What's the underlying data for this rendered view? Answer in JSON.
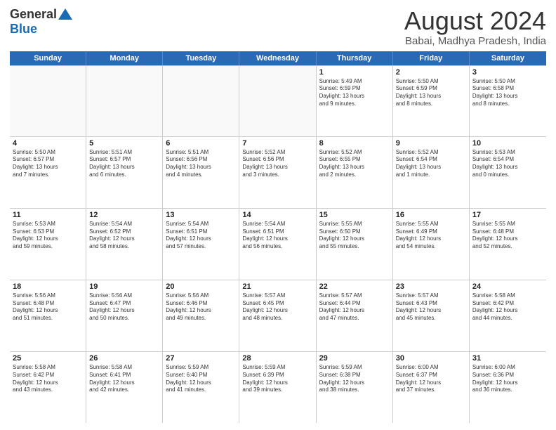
{
  "header": {
    "logo_general": "General",
    "logo_blue": "Blue",
    "month_title": "August 2024",
    "location": "Babai, Madhya Pradesh, India"
  },
  "days_of_week": [
    "Sunday",
    "Monday",
    "Tuesday",
    "Wednesday",
    "Thursday",
    "Friday",
    "Saturday"
  ],
  "weeks": [
    [
      {
        "day": "",
        "info": ""
      },
      {
        "day": "",
        "info": ""
      },
      {
        "day": "",
        "info": ""
      },
      {
        "day": "",
        "info": ""
      },
      {
        "day": "1",
        "info": "Sunrise: 5:49 AM\nSunset: 6:59 PM\nDaylight: 13 hours\nand 9 minutes."
      },
      {
        "day": "2",
        "info": "Sunrise: 5:50 AM\nSunset: 6:59 PM\nDaylight: 13 hours\nand 8 minutes."
      },
      {
        "day": "3",
        "info": "Sunrise: 5:50 AM\nSunset: 6:58 PM\nDaylight: 13 hours\nand 8 minutes."
      }
    ],
    [
      {
        "day": "4",
        "info": "Sunrise: 5:50 AM\nSunset: 6:57 PM\nDaylight: 13 hours\nand 7 minutes."
      },
      {
        "day": "5",
        "info": "Sunrise: 5:51 AM\nSunset: 6:57 PM\nDaylight: 13 hours\nand 6 minutes."
      },
      {
        "day": "6",
        "info": "Sunrise: 5:51 AM\nSunset: 6:56 PM\nDaylight: 13 hours\nand 4 minutes."
      },
      {
        "day": "7",
        "info": "Sunrise: 5:52 AM\nSunset: 6:56 PM\nDaylight: 13 hours\nand 3 minutes."
      },
      {
        "day": "8",
        "info": "Sunrise: 5:52 AM\nSunset: 6:55 PM\nDaylight: 13 hours\nand 2 minutes."
      },
      {
        "day": "9",
        "info": "Sunrise: 5:52 AM\nSunset: 6:54 PM\nDaylight: 13 hours\nand 1 minute."
      },
      {
        "day": "10",
        "info": "Sunrise: 5:53 AM\nSunset: 6:54 PM\nDaylight: 13 hours\nand 0 minutes."
      }
    ],
    [
      {
        "day": "11",
        "info": "Sunrise: 5:53 AM\nSunset: 6:53 PM\nDaylight: 12 hours\nand 59 minutes."
      },
      {
        "day": "12",
        "info": "Sunrise: 5:54 AM\nSunset: 6:52 PM\nDaylight: 12 hours\nand 58 minutes."
      },
      {
        "day": "13",
        "info": "Sunrise: 5:54 AM\nSunset: 6:51 PM\nDaylight: 12 hours\nand 57 minutes."
      },
      {
        "day": "14",
        "info": "Sunrise: 5:54 AM\nSunset: 6:51 PM\nDaylight: 12 hours\nand 56 minutes."
      },
      {
        "day": "15",
        "info": "Sunrise: 5:55 AM\nSunset: 6:50 PM\nDaylight: 12 hours\nand 55 minutes."
      },
      {
        "day": "16",
        "info": "Sunrise: 5:55 AM\nSunset: 6:49 PM\nDaylight: 12 hours\nand 54 minutes."
      },
      {
        "day": "17",
        "info": "Sunrise: 5:55 AM\nSunset: 6:48 PM\nDaylight: 12 hours\nand 52 minutes."
      }
    ],
    [
      {
        "day": "18",
        "info": "Sunrise: 5:56 AM\nSunset: 6:48 PM\nDaylight: 12 hours\nand 51 minutes."
      },
      {
        "day": "19",
        "info": "Sunrise: 5:56 AM\nSunset: 6:47 PM\nDaylight: 12 hours\nand 50 minutes."
      },
      {
        "day": "20",
        "info": "Sunrise: 5:56 AM\nSunset: 6:46 PM\nDaylight: 12 hours\nand 49 minutes."
      },
      {
        "day": "21",
        "info": "Sunrise: 5:57 AM\nSunset: 6:45 PM\nDaylight: 12 hours\nand 48 minutes."
      },
      {
        "day": "22",
        "info": "Sunrise: 5:57 AM\nSunset: 6:44 PM\nDaylight: 12 hours\nand 47 minutes."
      },
      {
        "day": "23",
        "info": "Sunrise: 5:57 AM\nSunset: 6:43 PM\nDaylight: 12 hours\nand 45 minutes."
      },
      {
        "day": "24",
        "info": "Sunrise: 5:58 AM\nSunset: 6:42 PM\nDaylight: 12 hours\nand 44 minutes."
      }
    ],
    [
      {
        "day": "25",
        "info": "Sunrise: 5:58 AM\nSunset: 6:42 PM\nDaylight: 12 hours\nand 43 minutes."
      },
      {
        "day": "26",
        "info": "Sunrise: 5:58 AM\nSunset: 6:41 PM\nDaylight: 12 hours\nand 42 minutes."
      },
      {
        "day": "27",
        "info": "Sunrise: 5:59 AM\nSunset: 6:40 PM\nDaylight: 12 hours\nand 41 minutes."
      },
      {
        "day": "28",
        "info": "Sunrise: 5:59 AM\nSunset: 6:39 PM\nDaylight: 12 hours\nand 39 minutes."
      },
      {
        "day": "29",
        "info": "Sunrise: 5:59 AM\nSunset: 6:38 PM\nDaylight: 12 hours\nand 38 minutes."
      },
      {
        "day": "30",
        "info": "Sunrise: 6:00 AM\nSunset: 6:37 PM\nDaylight: 12 hours\nand 37 minutes."
      },
      {
        "day": "31",
        "info": "Sunrise: 6:00 AM\nSunset: 6:36 PM\nDaylight: 12 hours\nand 36 minutes."
      }
    ]
  ]
}
